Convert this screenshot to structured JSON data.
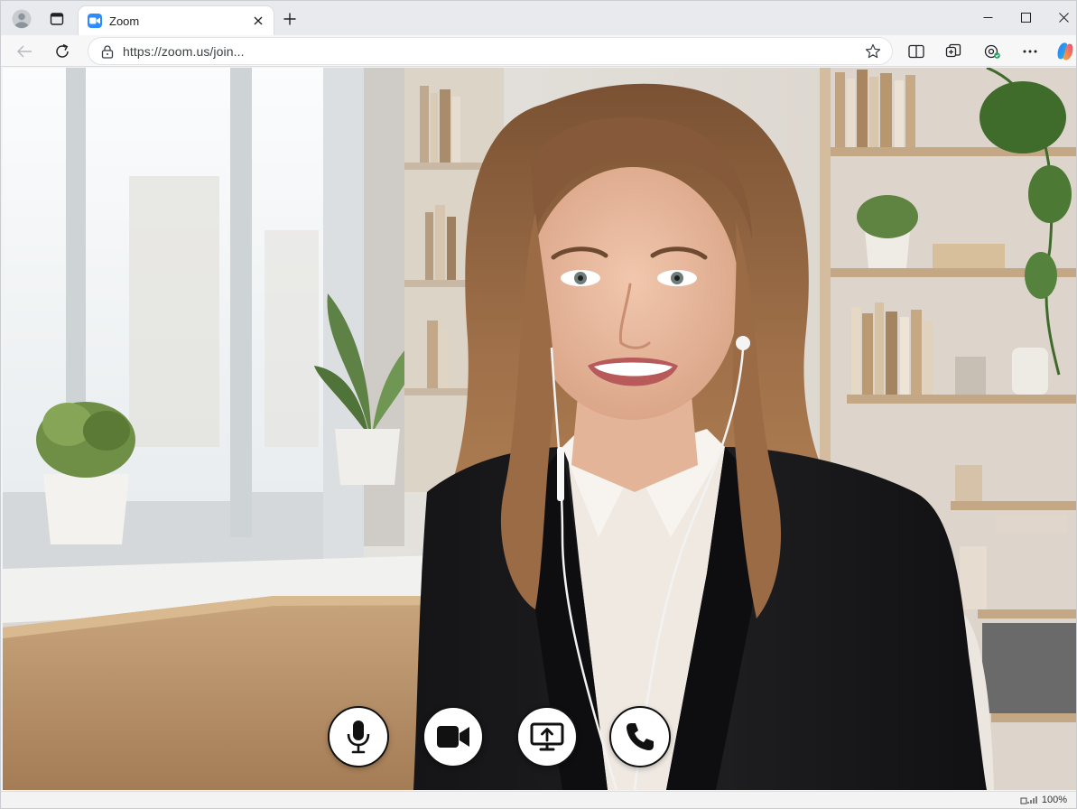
{
  "tab": {
    "title": "Zoom"
  },
  "address_bar": {
    "url": "https://zoom.us/join..."
  },
  "status_bar": {
    "zoom_level": "100%"
  },
  "colors": {
    "zoom_blue": "#2d8cff",
    "control_bg": "#ffffff",
    "control_icon": "#111111"
  },
  "icons": {
    "profile": "profile-icon",
    "tab_actions": "tab-actions-icon",
    "favicon": "zoom-camera-icon",
    "close_tab": "close-icon",
    "new_tab": "plus-icon",
    "back": "back-arrow-icon",
    "reload": "reload-icon",
    "site_info": "lock-icon",
    "favorite": "star-icon",
    "split_screen": "split-screen-icon",
    "collections": "collections-icon",
    "extensions": "extensions-icon",
    "more": "more-icon",
    "copilot": "copilot-icon",
    "mic": "microphone-icon",
    "camera": "video-camera-icon",
    "share": "share-screen-icon",
    "leave": "phone-icon"
  }
}
